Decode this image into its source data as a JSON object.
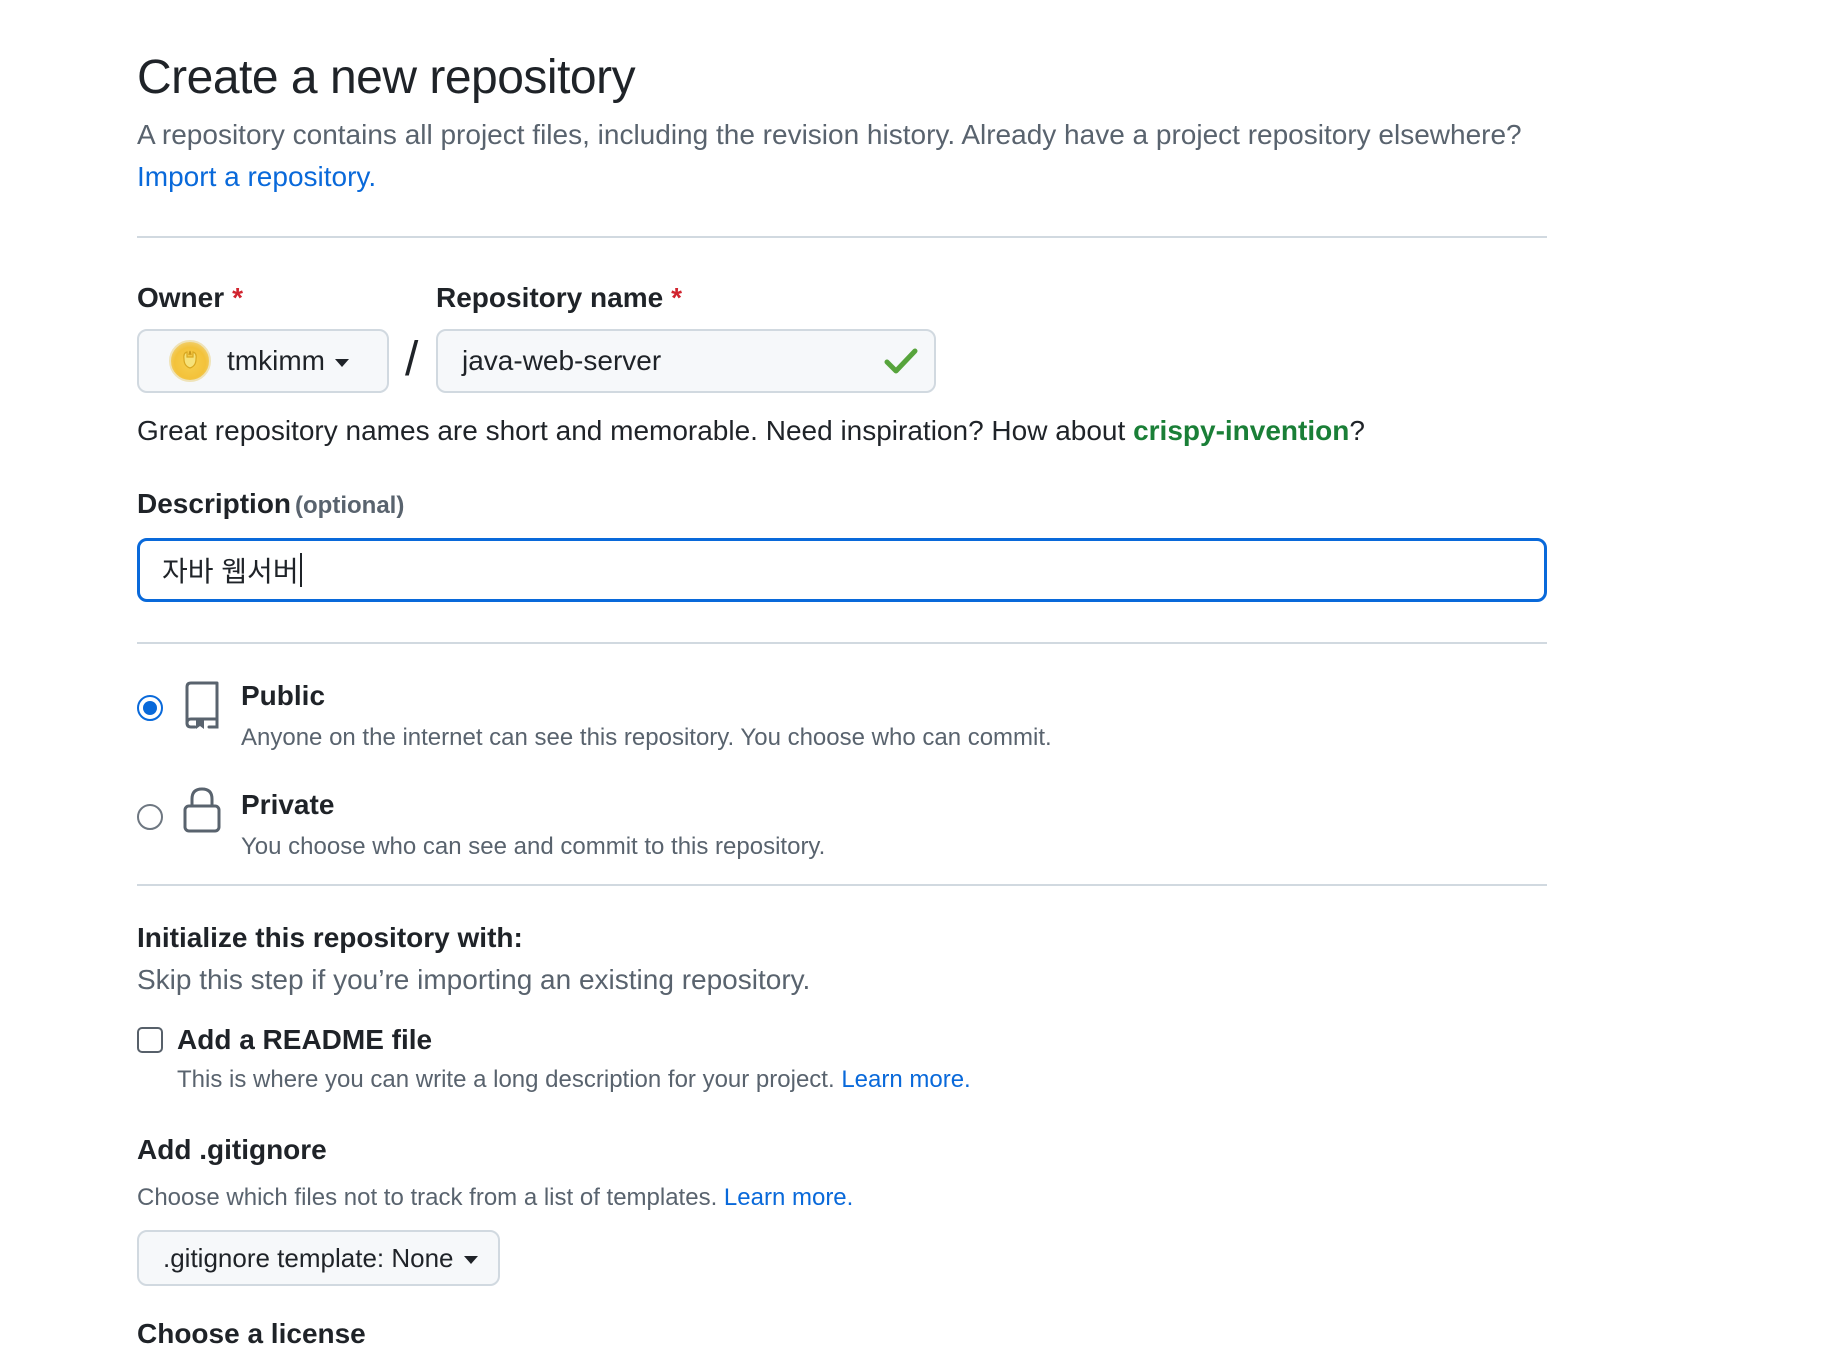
{
  "header": {
    "title": "Create a new repository",
    "subtitle_text": "A repository contains all project files, including the revision history. Already have a project repository elsewhere?",
    "import_link": "Import a repository."
  },
  "owner": {
    "label": "Owner",
    "required_mark": "*",
    "value": "tmkimm"
  },
  "separator": "/",
  "repo_name": {
    "label": "Repository name",
    "required_mark": "*",
    "value": "java-web-server",
    "valid": true
  },
  "name_hint": {
    "text": "Great repository names are short and memorable. Need inspiration? How about",
    "suggestion": "crispy-invention",
    "suffix": "?"
  },
  "description": {
    "label": "Description",
    "optional": "(optional)",
    "value": "자바 웹서버"
  },
  "visibility": {
    "selected": "public",
    "options": [
      {
        "id": "public",
        "title": "Public",
        "description": "Anyone on the internet can see this repository. You choose who can commit.",
        "icon": "repo-icon"
      },
      {
        "id": "private",
        "title": "Private",
        "description": "You choose who can see and commit to this repository.",
        "icon": "lock-icon"
      }
    ]
  },
  "initialize": {
    "title": "Initialize this repository with:",
    "subtitle": "Skip this step if you’re importing an existing repository.",
    "readme": {
      "label": "Add a README file",
      "checked": false,
      "description": "This is where you can write a long description for your project.",
      "learn_more": "Learn more."
    }
  },
  "gitignore": {
    "title": "Add .gitignore",
    "description": "Choose which files not to track from a list of templates.",
    "learn_more": "Learn more.",
    "button_label": ".gitignore template: None"
  },
  "license": {
    "title": "Choose a license"
  },
  "colors": {
    "link": "#0969da",
    "success": "#1a7f37",
    "required": "#d1242f",
    "focus_border": "#0969da"
  }
}
